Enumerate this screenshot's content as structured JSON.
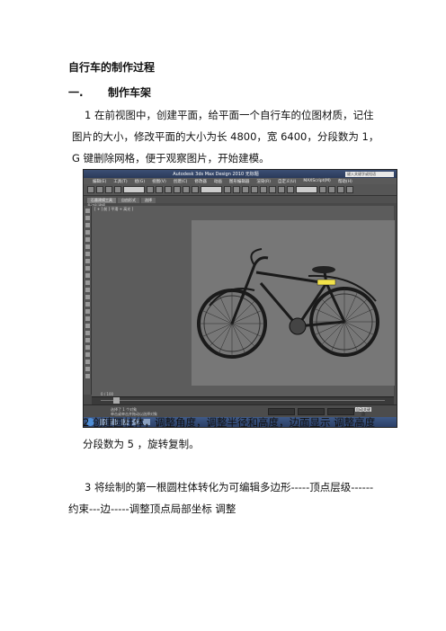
{
  "doc": {
    "title": "自行车的制作过程",
    "section_num": "一.",
    "section_title": "制作车架",
    "p1_l1": "1 在前视图中，创建平面，给平面一个自行车的位图材质，记住",
    "p1_l2": "图片的大小，修改平面的大小为长 4800，宽 6400，分段数为 1，",
    "p1_l3": "G 键删除网格，便于观察图片，开始建模。",
    "p2_l1": "2 创建圆柱体，调整角度，调整半径和高度，边面显示  调整高度",
    "p2_l2": "分段数为 5      ，旋转复制。",
    "p3_l1": "3  将绘制的第一根圆柱体转化为可编辑多边形-----顶点层级------",
    "p3_l2": "约束---边-----调整顶点局部坐标    调整"
  },
  "screenshot": {
    "window_title": "Autodesk 3ds Max Design 2010    无标题",
    "search_placeholder": "键入关键字或短语",
    "menu": [
      "编辑(E)",
      "工具(T)",
      "组(G)",
      "视图(V)",
      "创建(C)",
      "修改器",
      "动画",
      "图形编辑器",
      "渲染(R)",
      "自定义(U)",
      "MAXScript(M)",
      "帮助(H)"
    ],
    "ribbon_tabs": [
      "石墨建模工具",
      "自由形式",
      "选择"
    ],
    "subbar_label": "多边形建模",
    "viewport_label": "[ + ] 前 ] 平滑 + 高光 ]",
    "timeline_label": "0 / 100",
    "status_line1": "选择了 1 个对象",
    "status_line2": "单击或单击并拖动以选择对象",
    "auto_key": "自动关键点"
  }
}
